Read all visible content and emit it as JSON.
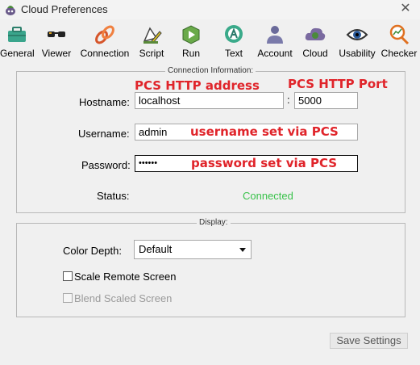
{
  "window": {
    "title": "Cloud Preferences",
    "close_glyph": "✕"
  },
  "toolbar": {
    "items": [
      {
        "label": "General",
        "icon": "toolbox-icon"
      },
      {
        "label": "Viewer",
        "icon": "glasses-icon"
      },
      {
        "label": "Connection",
        "icon": "chain-link-icon"
      },
      {
        "label": "Script",
        "icon": "script-pen-icon"
      },
      {
        "label": "Run",
        "icon": "run-arrow-icon"
      },
      {
        "label": "Text",
        "icon": "text-ocr-icon"
      },
      {
        "label": "Account",
        "icon": "account-person-icon"
      },
      {
        "label": "Cloud",
        "icon": "cloud-icon"
      },
      {
        "label": "Usability",
        "icon": "eye-icon"
      },
      {
        "label": "Checker",
        "icon": "magnifier-chart-icon"
      }
    ]
  },
  "connection": {
    "group_title": "Connection Information:",
    "hostname_label": "Hostname:",
    "hostname_value": "localhost",
    "port_separator": ":",
    "port_value": "5000",
    "username_label": "Username:",
    "username_value": "admin",
    "password_label": "Password:",
    "password_value": "••••••",
    "status_label": "Status:",
    "status_value": "Connected",
    "status_color": "#39c24a"
  },
  "annotations": {
    "http_address": "PCS HTTP address",
    "http_port": "PCS HTTP Port",
    "username_note": "username set via PCS",
    "password_note": "password set via PCS",
    "color": "#e0242a"
  },
  "display": {
    "group_title": "Display:",
    "color_depth_label": "Color Depth:",
    "color_depth_value": "Default",
    "scale_remote_label": "Scale Remote Screen",
    "scale_remote_checked": false,
    "blend_scaled_label": "Blend Scaled Screen",
    "blend_scaled_checked": false,
    "blend_scaled_enabled": false
  },
  "footer": {
    "save_label": "Save Settings"
  }
}
